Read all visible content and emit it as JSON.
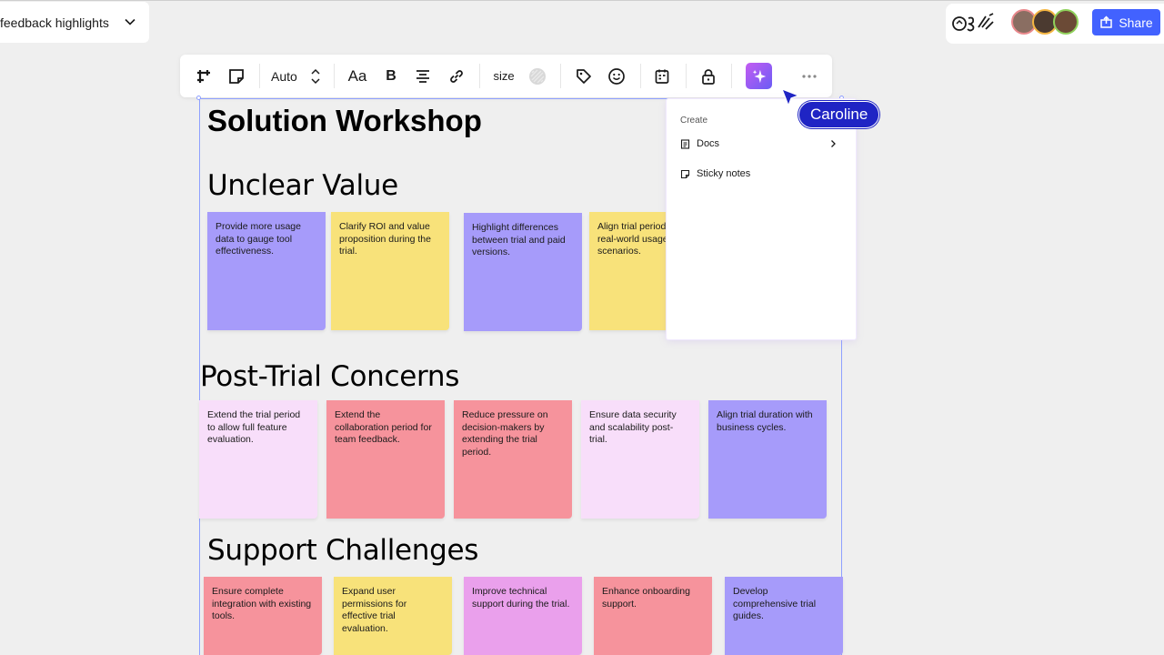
{
  "board": {
    "title": "feedback highlights"
  },
  "header": {
    "share_label": "Share",
    "avatars": [
      {
        "initials": "",
        "color": "#e9888c"
      },
      {
        "initials": "",
        "color": "#f5b642"
      },
      {
        "initials": "",
        "color": "#8fd15b"
      }
    ]
  },
  "toolbar": {
    "auto_label": "Auto",
    "font_label": "Aa",
    "bold_label": "B",
    "size_label": "size"
  },
  "frame": {
    "title": "Solution Workshop",
    "sections": [
      {
        "title": "Unclear Value",
        "stickies": [
          {
            "text": "Provide more usage data to gauge tool effectiveness.",
            "color": "violet"
          },
          {
            "text": "Clarify ROI and value proposition during the trial.",
            "color": "yellow"
          },
          {
            "text": "Highlight differences between trial and paid versions.",
            "color": "violet"
          },
          {
            "text": "Align trial period with real-world usage scenarios.",
            "color": "yellow"
          }
        ]
      },
      {
        "title": "Post-Trial Concerns",
        "stickies": [
          {
            "text": "Extend the trial period to allow full feature evaluation.",
            "color": "lightpink"
          },
          {
            "text": "Extend the collaboration period for team feedback.",
            "color": "coral"
          },
          {
            "text": "Reduce pressure on decision-makers by extending the trial period.",
            "color": "coral"
          },
          {
            "text": "Ensure data security and scalability post-trial.",
            "color": "lightpink"
          },
          {
            "text": "Align trial duration with business cycles.",
            "color": "violet"
          }
        ]
      },
      {
        "title": "Support Challenges",
        "stickies": [
          {
            "text": "Ensure complete integration with existing tools.",
            "color": "coral"
          },
          {
            "text": "Expand user permissions for effective trial evaluation.",
            "color": "yellow"
          },
          {
            "text": "Improve technical support during the trial.",
            "color": "pink"
          },
          {
            "text": "Enhance onboarding support.",
            "color": "coral"
          },
          {
            "text": "Develop comprehensive trial guides.",
            "color": "violet"
          }
        ]
      }
    ]
  },
  "create_menu": {
    "heading": "Create",
    "items": [
      {
        "label": "Docs"
      },
      {
        "label": "Sticky notes"
      }
    ]
  },
  "cursor": {
    "name": "Caroline"
  }
}
